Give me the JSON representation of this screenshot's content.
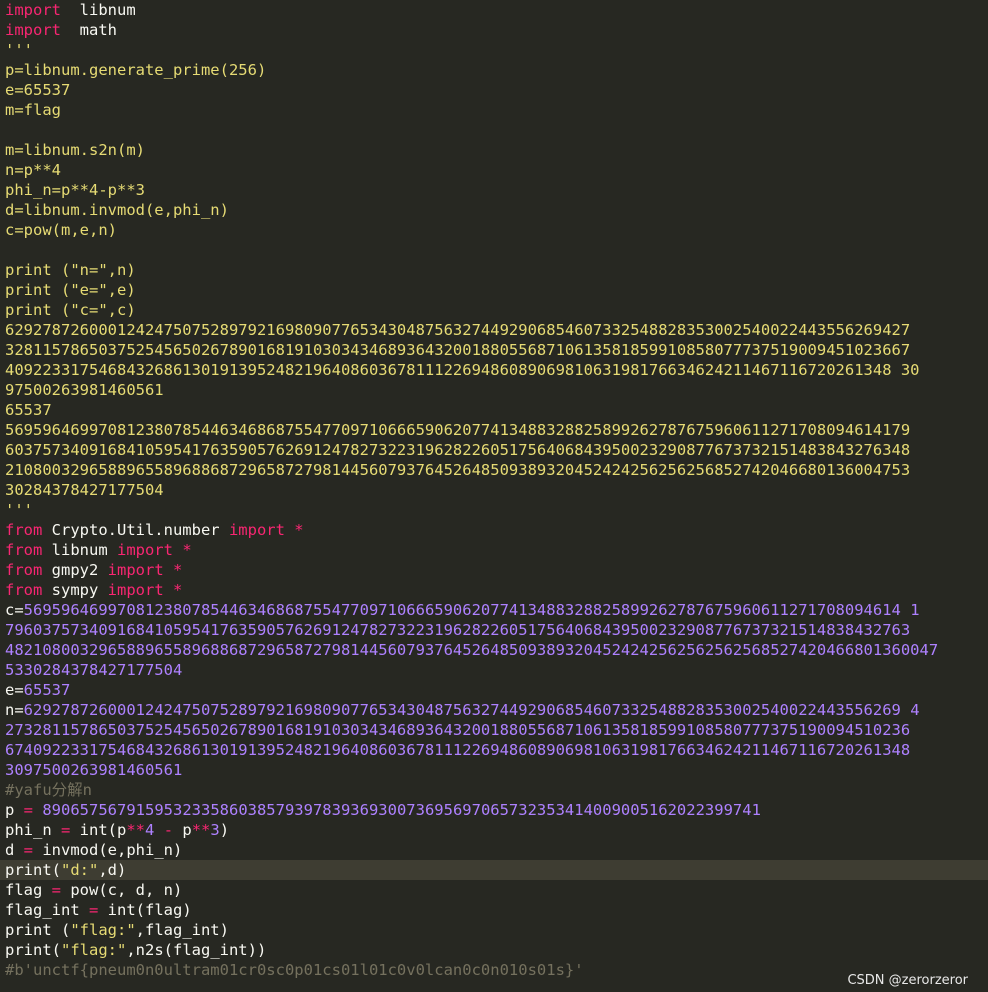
{
  "colors": {
    "background": "#272822",
    "keyword": "#f92672",
    "string": "#e6db74",
    "number": "#ae81ff",
    "comment": "#75715e",
    "default": "#f8f8f2",
    "current_line": "#3e3d32"
  },
  "current_line_index": 43,
  "lines": [
    [
      [
        "kw",
        "import"
      ],
      [
        "",
        "  libnum"
      ]
    ],
    [
      [
        "kw",
        "import"
      ],
      [
        "",
        "  math"
      ]
    ],
    [
      [
        "str",
        "'''"
      ]
    ],
    [
      [
        "str",
        "p=libnum.generate_prime(256)"
      ]
    ],
    [
      [
        "str",
        "e=65537"
      ]
    ],
    [
      [
        "str",
        "m=flag"
      ]
    ],
    [
      [
        "str",
        ""
      ]
    ],
    [
      [
        "str",
        "m=libnum.s2n(m)"
      ]
    ],
    [
      [
        "str",
        "n=p**4"
      ]
    ],
    [
      [
        "str",
        "phi_n=p**4-p**3"
      ]
    ],
    [
      [
        "str",
        "d=libnum.invmod(e,phi_n)"
      ]
    ],
    [
      [
        "str",
        "c=pow(m,e,n)"
      ]
    ],
    [
      [
        "str",
        ""
      ]
    ],
    [
      [
        "str",
        "print (\"n=\",n)"
      ]
    ],
    [
      [
        "str",
        "print (\"e=\",e)"
      ]
    ],
    [
      [
        "str",
        "print (\"c=\",c)"
      ]
    ],
    [
      [
        "str",
        "6292787260001242475075289792169809077653430487563274492906854607332548828353002540022443556269427"
      ]
    ],
    [
      [
        "str",
        "3281157865037525456502678901681910303434689364320018805568710613581859910858077737519009451023667"
      ]
    ],
    [
      [
        "str",
        "40922331754684326861301913952482196408603678111226948608906981063198176634624211467116720261348 30"
      ]
    ],
    [
      [
        "str",
        "97500263981460561"
      ]
    ],
    [
      [
        "str",
        "65537"
      ]
    ],
    [
      [
        "str",
        "5695964699708123807854463468687554770971066659062077413488328825899262787675960611271708094614179"
      ]
    ],
    [
      [
        "str",
        "6037573409168410595417635905762691247827322319628226051756406843950023290877673732151483843276348"
      ]
    ],
    [
      [
        "str",
        "2108003296588965589688687296587279814456079376452648509389320452424256256256852742046680136004753"
      ]
    ],
    [
      [
        "str",
        "30284378427177504"
      ]
    ],
    [
      [
        "str",
        "'''"
      ]
    ],
    [
      [
        "kw",
        "from"
      ],
      [
        "",
        " Crypto.Util.number "
      ],
      [
        "kw",
        "import"
      ],
      [
        "op",
        " *"
      ]
    ],
    [
      [
        "kw",
        "from"
      ],
      [
        "",
        " libnum "
      ],
      [
        "kw",
        "import"
      ],
      [
        "op",
        " *"
      ]
    ],
    [
      [
        "kw",
        "from"
      ],
      [
        "",
        " gmpy2 "
      ],
      [
        "kw",
        "import"
      ],
      [
        "op",
        " *"
      ]
    ],
    [
      [
        "kw",
        "from"
      ],
      [
        "",
        " sympy "
      ],
      [
        "kw",
        "import"
      ],
      [
        "op",
        " *"
      ]
    ],
    [
      [
        "",
        "c="
      ],
      [
        "num",
        "5695964699708123807854463468687554770971066659062077413488328825899262787675960611271708094614 1"
      ]
    ],
    [
      [
        "num",
        "7960375734091684105954176359057626912478273223196282260517564068439500232908776737321514838432763"
      ]
    ],
    [
      [
        "num",
        "4821080032965889655896886872965872798144560793764526485093893204524242562562562568527420466801360047"
      ]
    ],
    [
      [
        "num",
        "5330284378427177504"
      ]
    ],
    [
      [
        "",
        "e="
      ],
      [
        "num",
        "65537"
      ]
    ],
    [
      [
        "",
        "n="
      ],
      [
        "num",
        "6292787260001242475075289792169809077653430487563274492906854607332548828353002540022443556269 4"
      ]
    ],
    [
      [
        "num",
        "2732811578650375254565026789016819103034346893643200188055687106135818599108580777375190094510236"
      ]
    ],
    [
      [
        "num",
        "6740922331754684326861301913952482196408603678111226948608906981063198176634624211467116720261348"
      ]
    ],
    [
      [
        "num",
        "3097500263981460561"
      ]
    ],
    [
      [
        "cmt",
        "#yafu分解n"
      ]
    ],
    [
      [
        "",
        "p "
      ],
      [
        "op",
        "="
      ],
      [
        "num",
        " 89065756791595323358603857939783936930073695697065732353414009005162022399741"
      ]
    ],
    [
      [
        "",
        "phi_n "
      ],
      [
        "op",
        "="
      ],
      [
        "",
        " int(p"
      ],
      [
        "op",
        "**"
      ],
      [
        "num",
        "4"
      ],
      [
        "op",
        " - "
      ],
      [
        "",
        "p"
      ],
      [
        "op",
        "**"
      ],
      [
        "num",
        "3"
      ],
      [
        "",
        ")"
      ]
    ],
    [
      [
        "",
        "d "
      ],
      [
        "op",
        "="
      ],
      [
        "",
        " invmod(e,phi_n)"
      ]
    ],
    [
      [
        "",
        "print("
      ],
      [
        "str",
        "\"d:\""
      ],
      [
        "",
        ",d)"
      ]
    ],
    [
      [
        "",
        "flag "
      ],
      [
        "op",
        "="
      ],
      [
        "",
        " pow(c, d, n)"
      ]
    ],
    [
      [
        "",
        "flag_int "
      ],
      [
        "op",
        "="
      ],
      [
        "",
        " int(flag)"
      ]
    ],
    [
      [
        "",
        "print ("
      ],
      [
        "str",
        "\"flag:\""
      ],
      [
        "",
        ",flag_int)"
      ]
    ],
    [
      [
        "",
        "print("
      ],
      [
        "str",
        "\"flag:\""
      ],
      [
        "",
        ",n2s(flag_int))"
      ]
    ],
    [
      [
        "cmt",
        "#b'unctf{pneum0n0ultram01cr0sc0p01cs01l01c0v0lcan0c0n010s01s}'"
      ]
    ]
  ],
  "watermark": "CSDN @zerorzeror"
}
